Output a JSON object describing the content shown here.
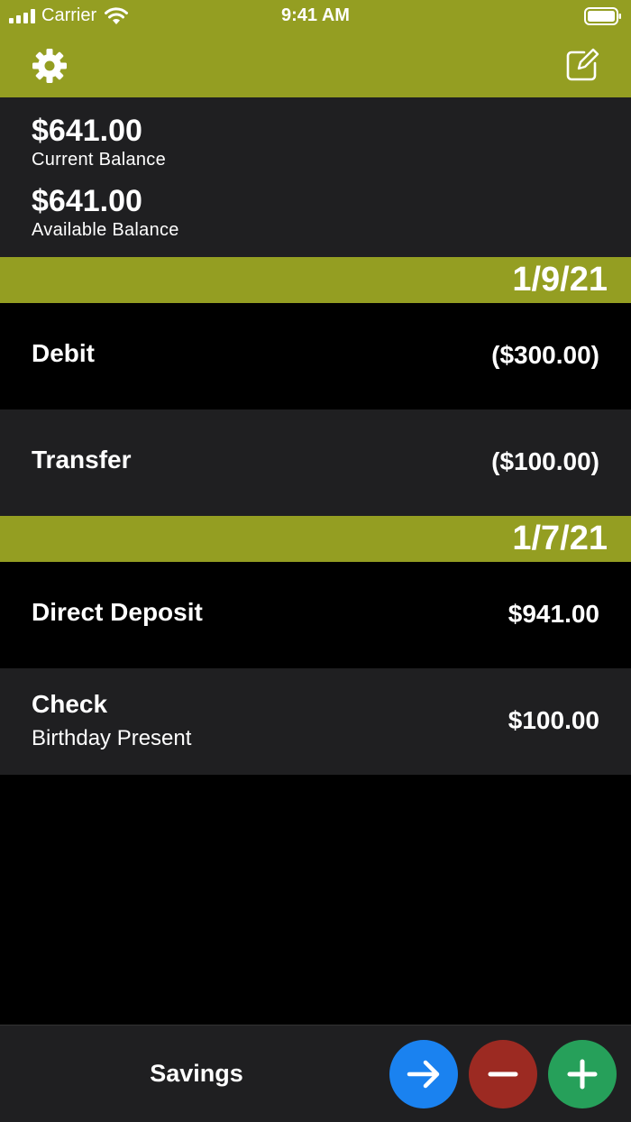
{
  "status_bar": {
    "carrier": "Carrier",
    "time": "9:41 AM"
  },
  "nav": {
    "settings_icon": "gear-icon",
    "compose_icon": "compose-icon"
  },
  "balances": {
    "current_amount": "$641.00",
    "current_label": "Current Balance",
    "available_amount": "$641.00",
    "available_label": "Available Balance"
  },
  "sections": [
    {
      "date": "1/9/21",
      "transactions": [
        {
          "title": "Debit",
          "subtitle": "",
          "amount": "($300.00)"
        },
        {
          "title": "Transfer",
          "subtitle": "",
          "amount": "($100.00)"
        }
      ]
    },
    {
      "date": "1/7/21",
      "transactions": [
        {
          "title": "Direct Deposit",
          "subtitle": "",
          "amount": "$941.00"
        },
        {
          "title": "Check",
          "subtitle": "Birthday Present",
          "amount": "$100.00"
        }
      ]
    }
  ],
  "bottom_bar": {
    "account_name": "Savings",
    "buttons": {
      "transfer_icon": "arrow-right-icon",
      "debit_icon": "minus-icon",
      "credit_icon": "plus-icon"
    }
  },
  "colors": {
    "accent": "#949e22",
    "transfer": "#1a82f0",
    "debit": "#9c2a22",
    "credit": "#26a05a",
    "cell": "#1f1f21"
  }
}
